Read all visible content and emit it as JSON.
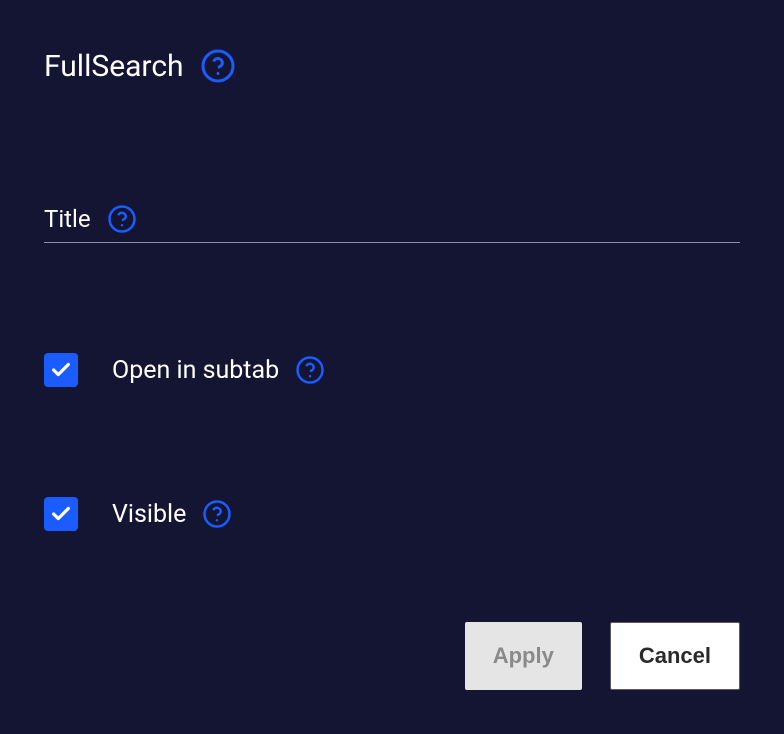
{
  "header": {
    "title": "FullSearch"
  },
  "form": {
    "title_field": {
      "label": "Title",
      "value": ""
    },
    "open_in_subtab": {
      "label": "Open in subtab",
      "checked": true
    },
    "visible": {
      "label": "Visible",
      "checked": true
    }
  },
  "buttons": {
    "apply": "Apply",
    "cancel": "Cancel"
  },
  "colors": {
    "background": "#141433",
    "accent": "#1a5cff",
    "help_icon": "#1a5cff"
  }
}
